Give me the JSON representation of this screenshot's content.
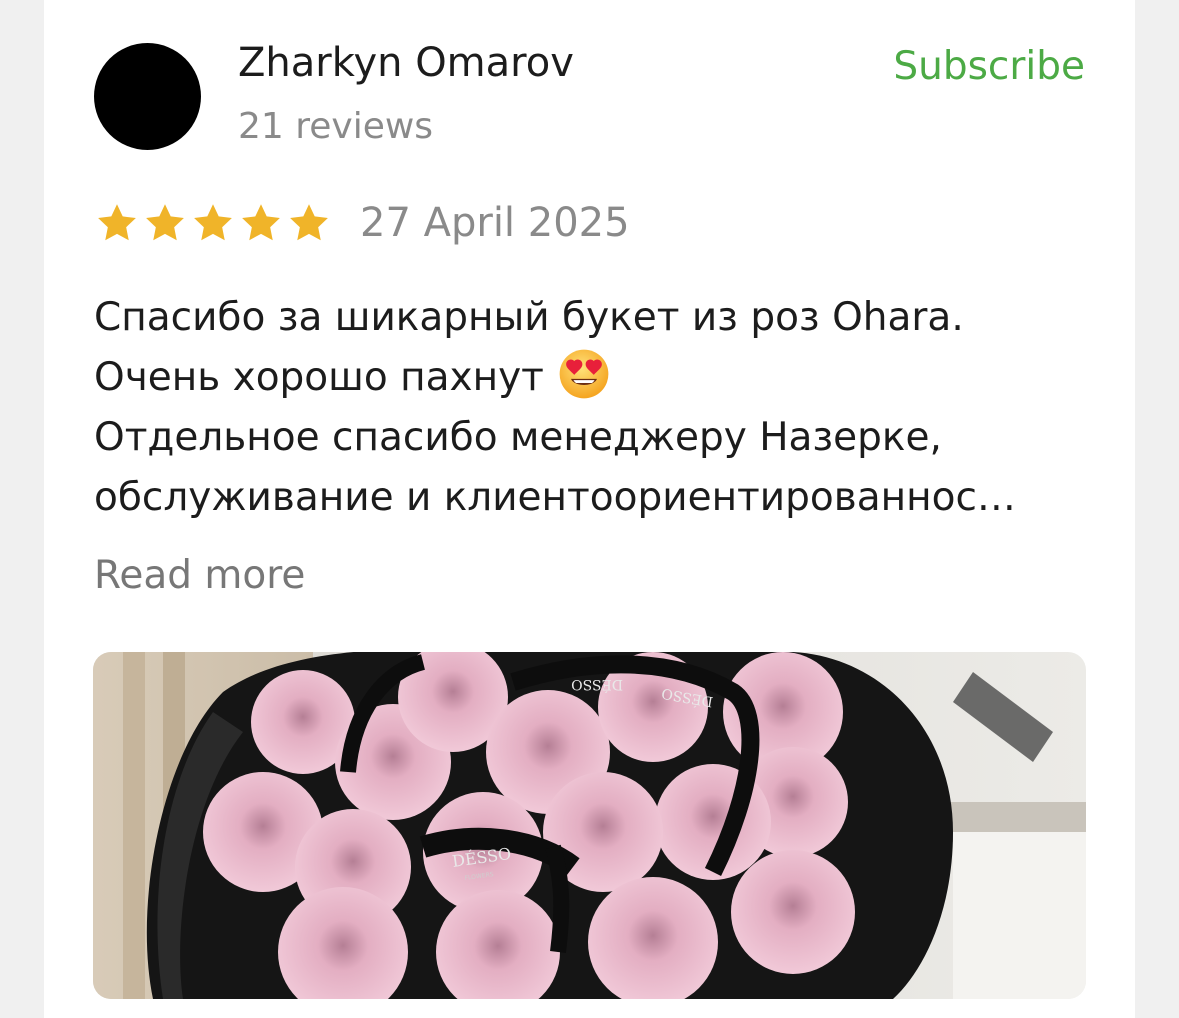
{
  "review": {
    "author": {
      "name": "Zharkyn Omarov",
      "reviews_count": "21 reviews"
    },
    "subscribe_label": "Subscribe",
    "rating": 5,
    "rating_max": 5,
    "date": "27 April 2025",
    "text_lines": [
      "Спасибо за шикарный букет из роз Ohara.",
      "Очень хорошо пахнут",
      "Отдельное спасибо менеджеру Назерке,",
      "обслуживание и клиентоориентированнос…"
    ],
    "emoji": "heart-eyes-emoji",
    "read_more_label": "Read more",
    "photo": {
      "ribbon_text": "DÉSSO",
      "ribbon_subtext": "FLOWERS"
    }
  },
  "colors": {
    "accent_green": "#4caa45",
    "star_gold": "#f0b429",
    "muted_text": "#8a8a8a",
    "background": "#f0f0f0"
  }
}
